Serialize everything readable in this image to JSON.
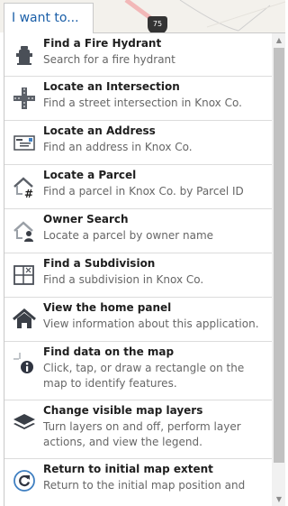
{
  "tab": {
    "label": "I want to..."
  },
  "map": {
    "shield_label": "75"
  },
  "items": [
    {
      "title": "Find a Fire Hydrant",
      "desc": "Search for a fire hydrant",
      "icon": "fire-hydrant-icon"
    },
    {
      "title": "Locate an Intersection",
      "desc": "Find a street intersection in Knox Co.",
      "icon": "intersection-icon"
    },
    {
      "title": "Locate an Address",
      "desc": "Find an address in Knox Co.",
      "icon": "address-icon"
    },
    {
      "title": "Locate a Parcel",
      "desc": "Find a parcel in Knox Co. by Parcel ID",
      "icon": "parcel-icon"
    },
    {
      "title": "Owner Search",
      "desc": "Locate a parcel by owner name",
      "icon": "owner-search-icon"
    },
    {
      "title": "Find a Subdivision",
      "desc": "Find a subdivision in Knox Co.",
      "icon": "subdivision-icon"
    },
    {
      "title": "View the home panel",
      "desc": "View information about this application.",
      "icon": "home-icon"
    },
    {
      "title": "Find data on the map",
      "desc": "Click, tap, or draw a rectangle on the map to identify features.",
      "icon": "identify-icon"
    },
    {
      "title": "Change visible map layers",
      "desc": "Turn layers on and off, perform layer actions, and view the legend.",
      "icon": "layers-icon"
    },
    {
      "title": "Return to initial map extent",
      "desc": "Return to the initial map position and",
      "icon": "initial-extent-icon"
    }
  ],
  "scrollbar": {
    "up_glyph": "▲",
    "down_glyph": "▼"
  },
  "colors": {
    "tab_text": "#1b5fa8",
    "title": "#1e1e1e",
    "desc": "#666666",
    "divider": "#dcdcdc",
    "icon": "#4a4f57"
  }
}
